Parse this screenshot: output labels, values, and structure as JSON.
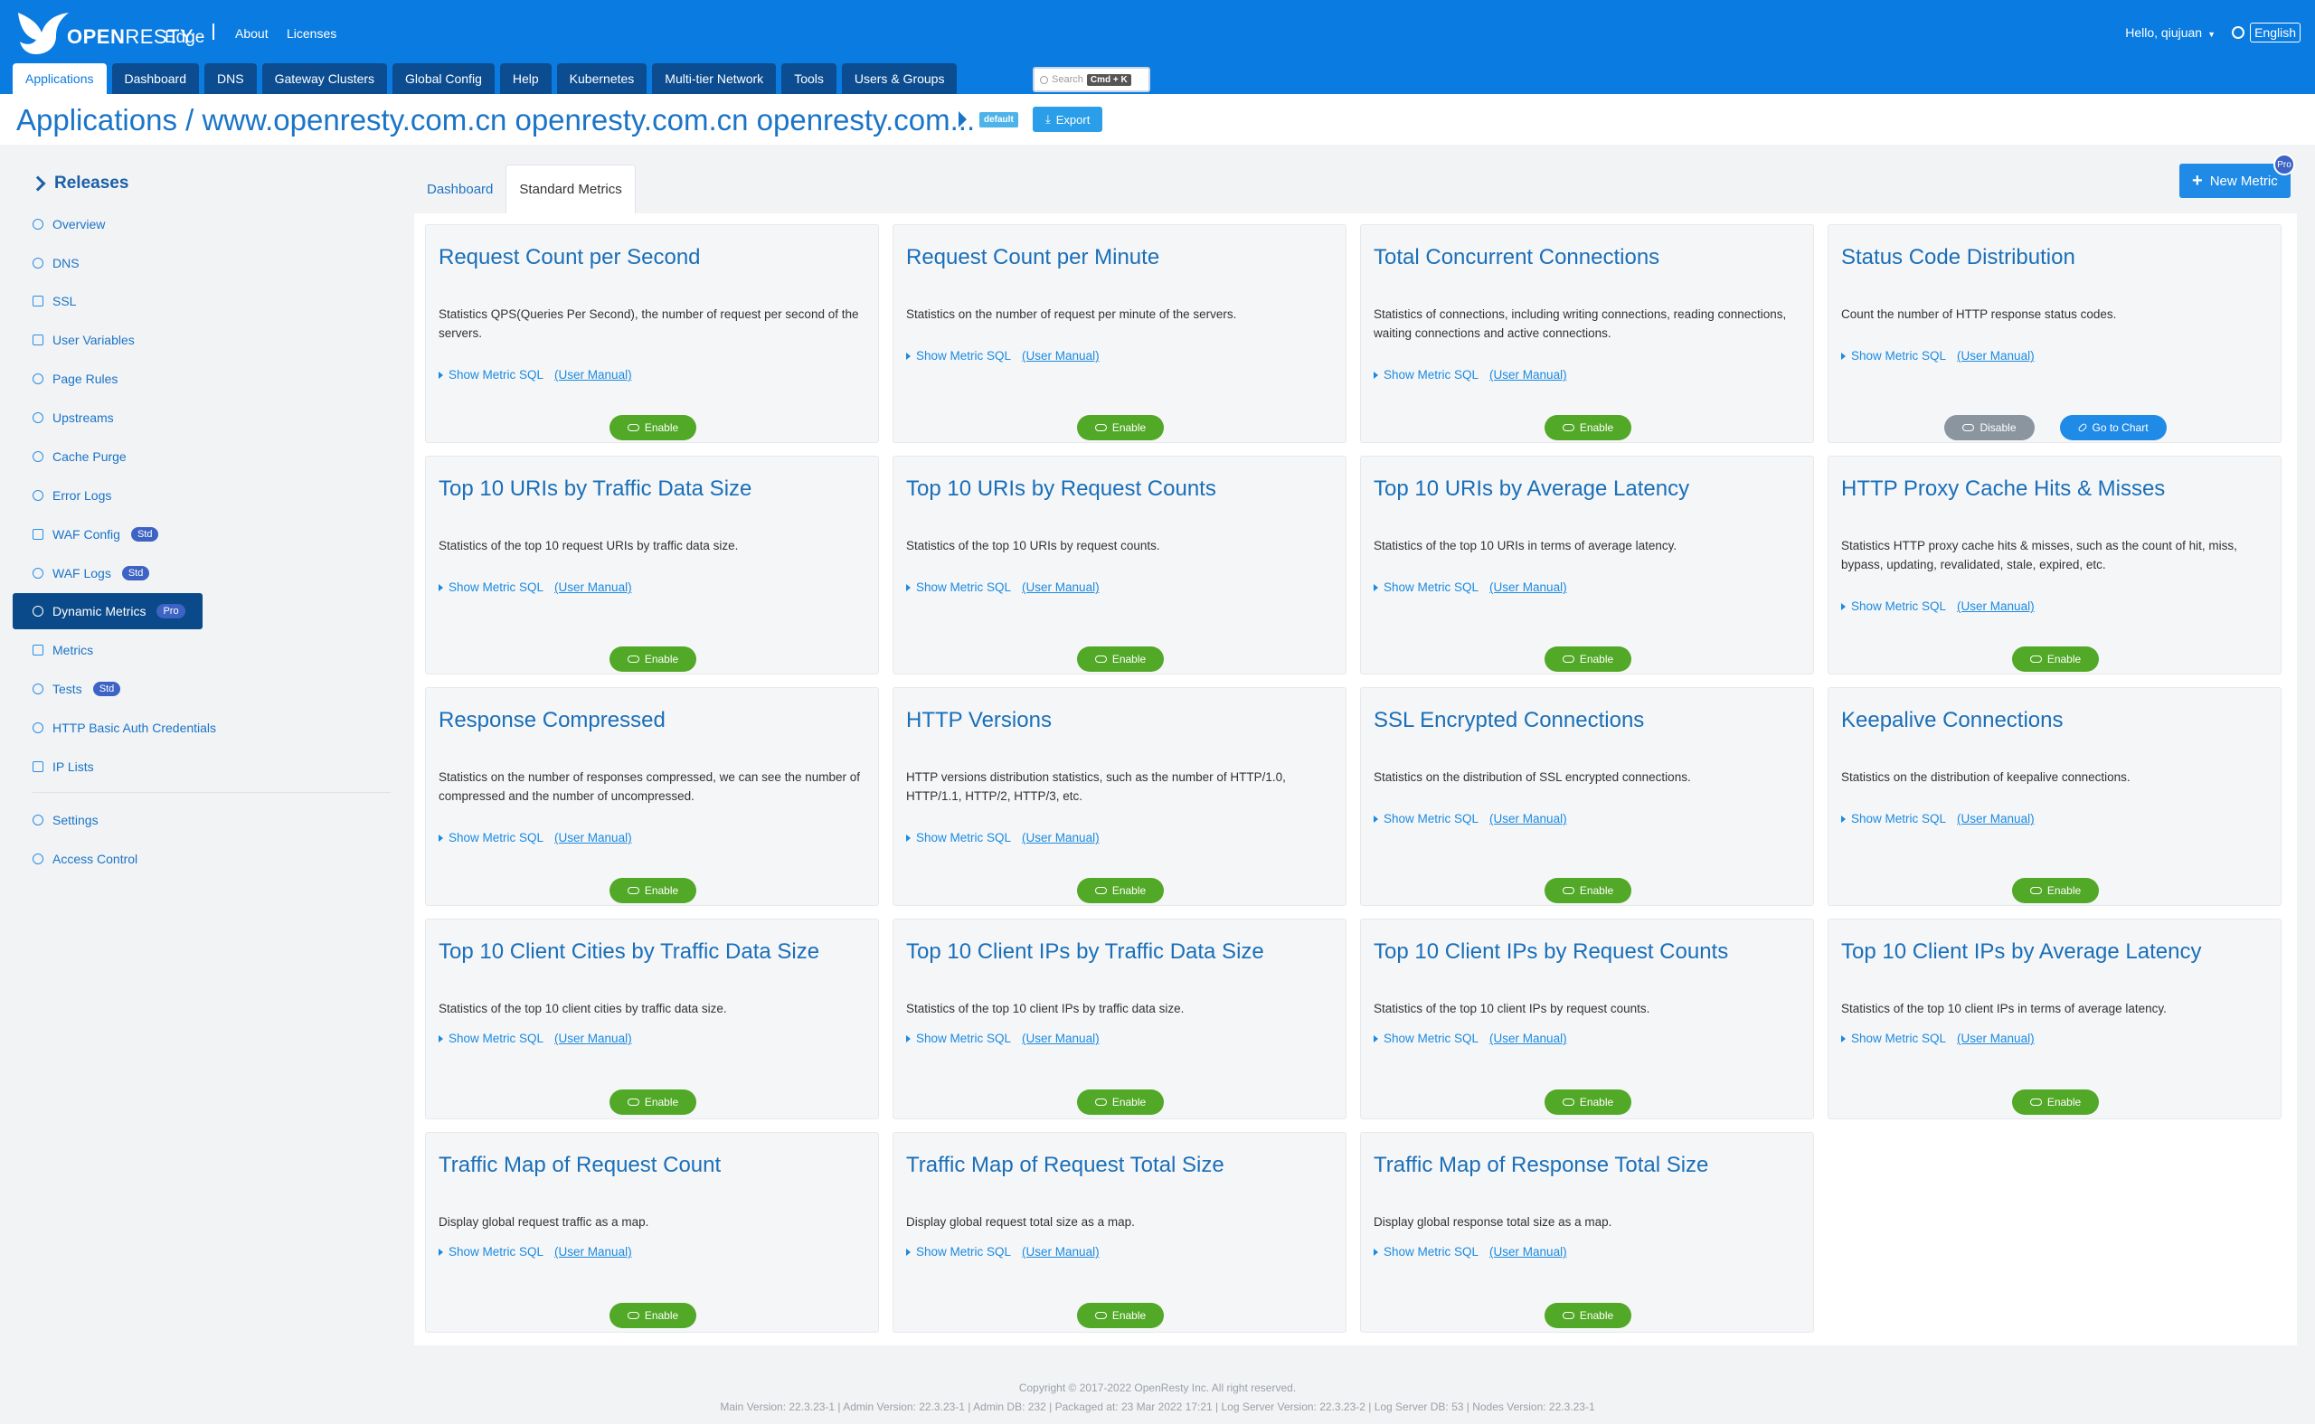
{
  "header": {
    "logo_text_bold": "OPEN",
    "logo_text_thin": "RESTY",
    "product": "Edge",
    "links": [
      "About",
      "Licenses"
    ],
    "user": "Hello, qiujuan",
    "language": "English",
    "colors": {
      "header_bg": "#0a7be0",
      "nav_tab_bg": "#0c4d91"
    }
  },
  "nav": {
    "tabs": [
      "Applications",
      "Dashboard",
      "DNS",
      "Gateway Clusters",
      "Global Config",
      "Help",
      "Kubernetes",
      "Multi-tier Network",
      "Tools",
      "Users & Groups"
    ],
    "search_placeholder": "Search",
    "search_shortcut": "Cmd + K"
  },
  "titlebar": {
    "title": "Applications  /  www.openresty.com.cn openresty.com.cn openresty.com...",
    "badge": "default",
    "export_label": "Export"
  },
  "sidebar": {
    "section": "Releases",
    "items": [
      {
        "label": "Overview",
        "icon": "dashboard-icon"
      },
      {
        "label": "DNS",
        "icon": "database-icon"
      },
      {
        "label": "SSL",
        "icon": "ssl-icon"
      },
      {
        "label": "User Variables",
        "icon": "variable-icon"
      },
      {
        "label": "Page Rules",
        "icon": "rules-icon"
      },
      {
        "label": "Upstreams",
        "icon": "upstream-icon"
      },
      {
        "label": "Cache Purge",
        "icon": "purge-icon"
      },
      {
        "label": "Error Logs",
        "icon": "error-log-icon"
      },
      {
        "label": "WAF Config",
        "icon": "waf-config-icon",
        "badge": "Std"
      },
      {
        "label": "WAF Logs",
        "icon": "waf-logs-icon",
        "badge": "Std"
      },
      {
        "label": "Dynamic Metrics",
        "icon": "dynamic-metrics-icon",
        "badge": "Pro"
      },
      {
        "label": "Metrics",
        "icon": "metrics-icon"
      },
      {
        "label": "Tests",
        "icon": "tests-icon",
        "badge": "Std"
      },
      {
        "label": "HTTP Basic Auth Credentials",
        "icon": "auth-icon"
      },
      {
        "label": "IP Lists",
        "icon": "list-icon"
      }
    ],
    "bottom_items": [
      {
        "label": "Settings",
        "icon": "gear-icon"
      },
      {
        "label": "Access Control",
        "icon": "user-icon"
      }
    ]
  },
  "main": {
    "tabs": [
      "Dashboard",
      "Standard Metrics"
    ],
    "new_metric_label": "New Metric",
    "pro_badge": "Pro",
    "show_sql": "Show Metric SQL",
    "user_manual": "(User Manual)",
    "enable_label": "Enable",
    "disable_label": "Disable",
    "go_to_chart_label": "Go to Chart",
    "cards": [
      {
        "title": "Request Count per Second",
        "desc": "Statistics QPS(Queries Per Second), the number of request per second of the servers."
      },
      {
        "title": "Request Count per Minute",
        "desc": "Statistics on the number of request per minute of the servers."
      },
      {
        "title": "Total Concurrent Connections",
        "desc": "Statistics of connections, including writing connections, reading connections, waiting connections and active connections."
      },
      {
        "title": "Status Code Distribution",
        "desc": "Count the number of HTTP response status codes.",
        "enabled": true
      },
      {
        "title": "Top 10 URIs by Traffic Data Size",
        "desc": "Statistics of the top 10 request URIs by traffic data size."
      },
      {
        "title": "Top 10 URIs by Request Counts",
        "desc": "Statistics of the top 10 URIs by request counts."
      },
      {
        "title": "Top 10 URIs by Average Latency",
        "desc": "Statistics of the top 10 URIs in terms of average latency."
      },
      {
        "title": "HTTP Proxy Cache Hits & Misses",
        "desc": "Statistics HTTP proxy cache hits & misses, such as the count of hit, miss, bypass, updating, revalidated, stale, expired, etc."
      },
      {
        "title": "Response Compressed",
        "desc": "Statistics on the number of responses compressed, we can see the number of compressed and the number of uncompressed."
      },
      {
        "title": "HTTP Versions",
        "desc": "HTTP versions distribution statistics, such as the number of HTTP/1.0, HTTP/1.1, HTTP/2, HTTP/3, etc."
      },
      {
        "title": "SSL Encrypted Connections",
        "desc": "Statistics on the distribution of SSL encrypted connections."
      },
      {
        "title": "Keepalive Connections",
        "desc": "Statistics on the distribution of keepalive connections."
      },
      {
        "title": "Top 10 Client Cities by Traffic Data Size",
        "desc": "Statistics of the top 10 client cities by traffic data size."
      },
      {
        "title": "Top 10 Client IPs by Traffic Data Size",
        "desc": "Statistics of the top 10 client IPs by traffic data size."
      },
      {
        "title": "Top 10 Client IPs by Request Counts",
        "desc": "Statistics of the top 10 client IPs by request counts."
      },
      {
        "title": "Top 10 Client IPs by Average Latency",
        "desc": "Statistics of the top 10 client IPs in terms of average latency."
      },
      {
        "title": "Traffic Map of Request Count",
        "desc": "Display global request traffic as a map."
      },
      {
        "title": "Traffic Map of Request Total Size",
        "desc": "Display global request total size as a map."
      },
      {
        "title": "Traffic Map of Response Total Size",
        "desc": "Display global response total size as a map."
      }
    ],
    "colors": {
      "enable": "#52a827",
      "disable": "#8b959f",
      "chart": "#1f8be6",
      "title": "#1a6fb8"
    }
  },
  "footer": {
    "copyright": "Copyright © 2017-2022 OpenResty Inc. All right reserved.",
    "versions": "Main Version: 22.3.23-1  |  Admin Version: 22.3.23-1  |  Admin DB: 232  |  Packaged at: 23 Mar 2022 17:21  |  Log Server Version: 22.3.23-2  |  Log Server DB: 53  |  Nodes Version: 22.3.23-1"
  }
}
